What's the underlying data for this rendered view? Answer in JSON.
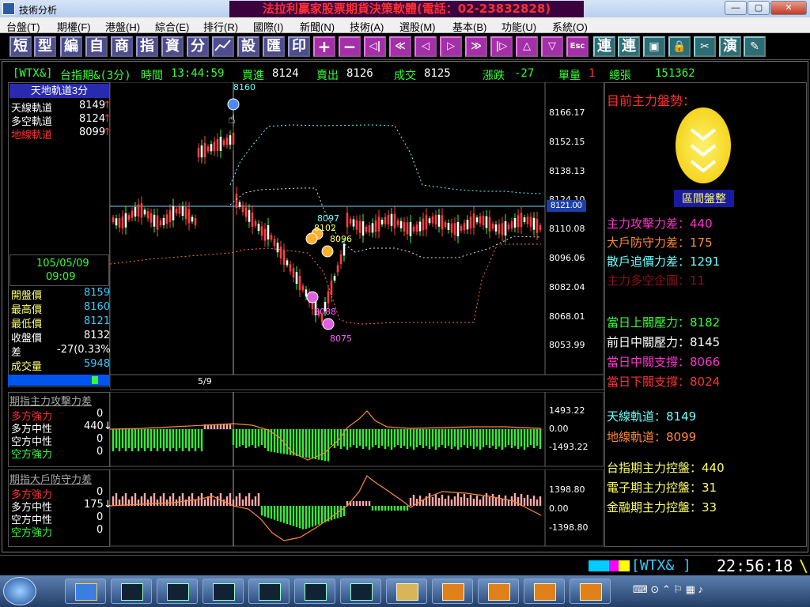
{
  "window": {
    "title": "技術分析",
    "headline": "法拉利贏家股票期貨決策軟體(電話：02-23832828)",
    "controls": [
      "—",
      "▢",
      "✕"
    ]
  },
  "menu": [
    "台盤(T)",
    "期權(F)",
    "港盤(H)",
    "綜合(E)",
    "排行(R)",
    "國際(I)",
    "新聞(N)",
    "技術(A)",
    "選股(M)",
    "基本(B)",
    "功能(U)",
    "系統(O)"
  ],
  "toolbar": {
    "left": [
      "短",
      "型",
      "編",
      "自",
      "商",
      "指",
      "資",
      "分",
      "",
      "設",
      "匯",
      "印"
    ],
    "nav": [
      "+",
      "−",
      "◁|",
      "≪",
      "◁",
      "▷",
      "≫",
      "|▷",
      "△",
      "▽",
      "Esc"
    ],
    "right": [
      "連",
      "連",
      "",
      "",
      "",
      "演",
      ""
    ]
  },
  "infobar": {
    "code": "[WTX&]",
    "name": "台指期&(3分)",
    "time_label": "時間",
    "time": "13:44:59",
    "buy_label": "買進",
    "buy": "8124",
    "sell_label": "賣出",
    "sell": "8126",
    "deal_label": "成交",
    "deal": "8125",
    "change_label": "漲跌",
    "change": "-27",
    "vol_label": "單量",
    "vol": "1",
    "total_label": "總張",
    "total": "151362"
  },
  "left_panel": {
    "header": "天地軌道3分",
    "tracks": [
      {
        "label": "天線軌道",
        "value": "8149",
        "arrow": "↑",
        "color": "#ffffff"
      },
      {
        "label": "多空軌道",
        "value": "8124",
        "arrow": "↑",
        "color": "#ffffff"
      },
      {
        "label": "地線軌道",
        "value": "8099",
        "arrow": "↑",
        "color": "#ff3030"
      }
    ],
    "date": "105/05/09",
    "clock": "09:09",
    "quotes": [
      {
        "label": "開盤價",
        "value": "8159",
        "color": "#ffff66",
        "vcolor": "#33ccff"
      },
      {
        "label": "最高價",
        "value": "8160",
        "color": "#ffff66",
        "vcolor": "#33ccff"
      },
      {
        "label": "最低價",
        "value": "8121",
        "color": "#ffff66",
        "vcolor": "#33ccff"
      },
      {
        "label": "收盤價",
        "value": "8132",
        "color": "#ffffff",
        "vcolor": "#ffffff"
      },
      {
        "label": "差",
        "value": "-27(0.33%)",
        "color": "#ffffff",
        "vcolor": "#ffffff"
      },
      {
        "label": "成交量",
        "value": "5948",
        "color": "#ffff66",
        "vcolor": "#33ccff"
      }
    ]
  },
  "main_chart": {
    "y_ticks": [
      "8166.17",
      "8152.15",
      "8138.13",
      "8124.10",
      "8110.08",
      "8096.06",
      "8082.04",
      "8068.01",
      "8053.99"
    ],
    "current_price_tag": "8121.00",
    "x_label": "5/9",
    "markers": [
      "8160",
      "8097",
      "8102",
      "8096",
      "8088",
      "8075"
    ]
  },
  "sub1": {
    "title": "期指主力攻擊力差",
    "rows": [
      {
        "label": "多方強力",
        "value": "0",
        "color": "#ff3030"
      },
      {
        "label": "多方中性",
        "value": "440↓",
        "color": "#ffffff"
      },
      {
        "label": "空方中性",
        "value": "0",
        "color": "#ffffff"
      },
      {
        "label": "空方強力",
        "value": "0",
        "color": "#33ff33"
      }
    ],
    "y_ticks": [
      "1493.22",
      "0.00",
      "-1493.22"
    ]
  },
  "sub2": {
    "title": "期指大戶防守力差",
    "rows": [
      {
        "label": "多方強力",
        "value": "0",
        "color": "#ff3030"
      },
      {
        "label": "多方中性",
        "value": "175↓",
        "color": "#ffffff"
      },
      {
        "label": "空方中性",
        "value": "0",
        "color": "#ffffff"
      },
      {
        "label": "空方強力",
        "value": "0",
        "color": "#33ff33"
      }
    ],
    "y_ticks": [
      "1398.80",
      "0.00",
      "-1398.80"
    ]
  },
  "right_panel": {
    "title": "目前主力盤勢：",
    "status": "區間盤整",
    "force": [
      {
        "text": "主力攻擊力差：440",
        "color": "#ff33cc"
      },
      {
        "text": "大戶防守力差：175",
        "color": "#ff8833"
      },
      {
        "text": "散戶追價力差：1291",
        "color": "#66ffff"
      },
      {
        "text": "主力多空企圖：11",
        "color": "#8a1020"
      }
    ],
    "levels": [
      {
        "text": "當日上關壓力：8182",
        "color": "#33ff33"
      },
      {
        "text": "前日中關壓力：8145",
        "color": "#ffffff"
      },
      {
        "text": "當日中關支撐：8066",
        "color": "#ff33cc"
      },
      {
        "text": "當日下關支撐：8024",
        "color": "#ff3030"
      }
    ],
    "tracks": [
      {
        "text": "天線軌道：8149",
        "color": "#66ffff"
      },
      {
        "text": "地線軌道：8099",
        "color": "#ff8833"
      }
    ],
    "control": [
      {
        "text": "台指期主力控盤：440",
        "color": "#ffff66"
      },
      {
        "text": "電子期主力控盤：31",
        "color": "#ffff66"
      },
      {
        "text": "金融期主力控盤：33",
        "color": "#ffff66"
      }
    ]
  },
  "status": {
    "code_field": "[WTX&  ]",
    "clock": "22:56:18",
    "tail": "\\"
  }
}
